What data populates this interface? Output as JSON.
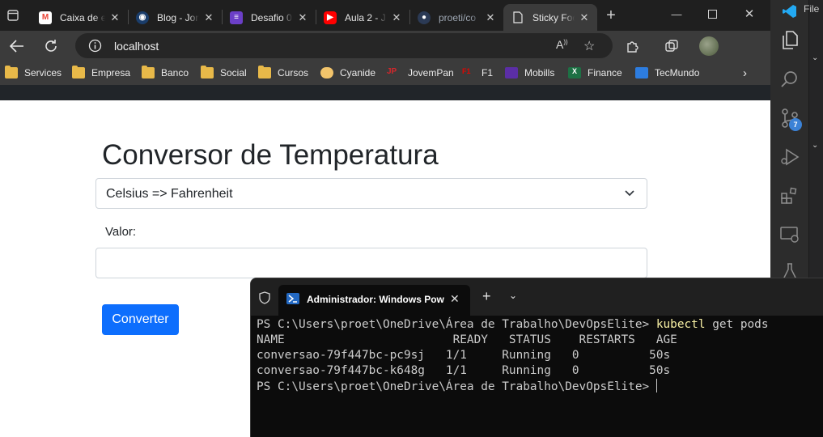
{
  "browser": {
    "tabs": [
      {
        "label": "Caixa de e",
        "favicon": "gmail-icon",
        "color": "#ea4335",
        "badge": "6"
      },
      {
        "label": "Blog - Jon",
        "favicon": "blog-icon",
        "color": "#1a3d6b"
      },
      {
        "label": "Desafio 0",
        "favicon": "list-icon",
        "color": "#6b3fc7"
      },
      {
        "label": "Aula 2 - J",
        "favicon": "youtube-icon",
        "color": "#ff0000"
      },
      {
        "label": "proeti/co",
        "favicon": "github-icon",
        "color": "#2b3a55"
      },
      {
        "label": "Sticky Foo",
        "favicon": "page-icon",
        "color": "#3b3b3b",
        "active": true
      }
    ],
    "url": "localhost",
    "bookmarks": [
      {
        "label": "Services",
        "icon": "folder-icon"
      },
      {
        "label": "Empresa",
        "icon": "folder-icon"
      },
      {
        "label": "Banco",
        "icon": "folder-icon"
      },
      {
        "label": "Social",
        "icon": "folder-icon"
      },
      {
        "label": "Cursos",
        "icon": "folder-icon"
      },
      {
        "label": "Cyanide",
        "icon": "cyanide-icon"
      },
      {
        "label": "JovemPan",
        "icon": "jovempan-icon"
      },
      {
        "label": "F1",
        "icon": "f1-icon"
      },
      {
        "label": "Mobills",
        "icon": "mobills-icon"
      },
      {
        "label": "Finance",
        "icon": "excel-icon"
      },
      {
        "label": "TecMundo",
        "icon": "tecmundo-icon"
      }
    ]
  },
  "page": {
    "title": "Conversor de Temperatura",
    "select_value": "Celsius => Fahrenheit",
    "value_label": "Valor:",
    "value_input": "",
    "convert_label": "Converter"
  },
  "vscode": {
    "menu_file": "File",
    "source_control_badge": "7"
  },
  "terminal": {
    "tab_title": "Administrador: Windows Pow",
    "prompt1": "PS C:\\Users\\proet\\OneDrive\\Área de Trabalho\\DevOpsElite>",
    "command_name": "kubectl",
    "command_args": "get pods",
    "header": "NAME                        READY   STATUS    RESTARTS   AGE",
    "rows": [
      "conversao-79f447bc-pc9sj   1/1     Running   0          50s",
      "conversao-79f447bc-k648g   1/1     Running   0          50s"
    ],
    "prompt2": "PS C:\\Users\\proet\\OneDrive\\Área de Trabalho\\DevOpsElite>"
  }
}
